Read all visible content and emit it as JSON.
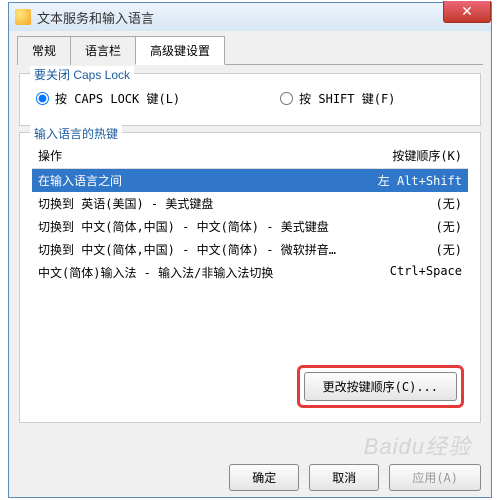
{
  "window": {
    "title": "文本服务和输入语言"
  },
  "tabs": [
    "常规",
    "语言栏",
    "高级键设置"
  ],
  "activeTab": 2,
  "capslock": {
    "title": "要关闭 Caps Lock",
    "opt1": "按 CAPS LOCK 键(L)",
    "opt2": "按 SHIFT 键(F)"
  },
  "hotkeys": {
    "title": "输入语言的热键",
    "col_action": "操作",
    "col_keys": "按键顺序(K)",
    "rows": [
      {
        "action": "在输入语言之间",
        "keys": "左 Alt+Shift",
        "selected": true
      },
      {
        "action": "切换到 英语(美国) - 美式键盘",
        "keys": "(无)"
      },
      {
        "action": "切换到 中文(简体,中国) - 中文(简体) - 美式键盘",
        "keys": "(无)"
      },
      {
        "action": "切换到 中文(简体,中国) - 中文(简体) - 微软拼音…",
        "keys": "(无)"
      },
      {
        "action": "中文(简体)输入法 - 输入法/非输入法切换",
        "keys": "Ctrl+Space"
      }
    ],
    "change_btn": "更改按键顺序(C)..."
  },
  "buttons": {
    "ok": "确定",
    "cancel": "取消",
    "apply": "应用(A)"
  },
  "watermark": "Baidu经验"
}
